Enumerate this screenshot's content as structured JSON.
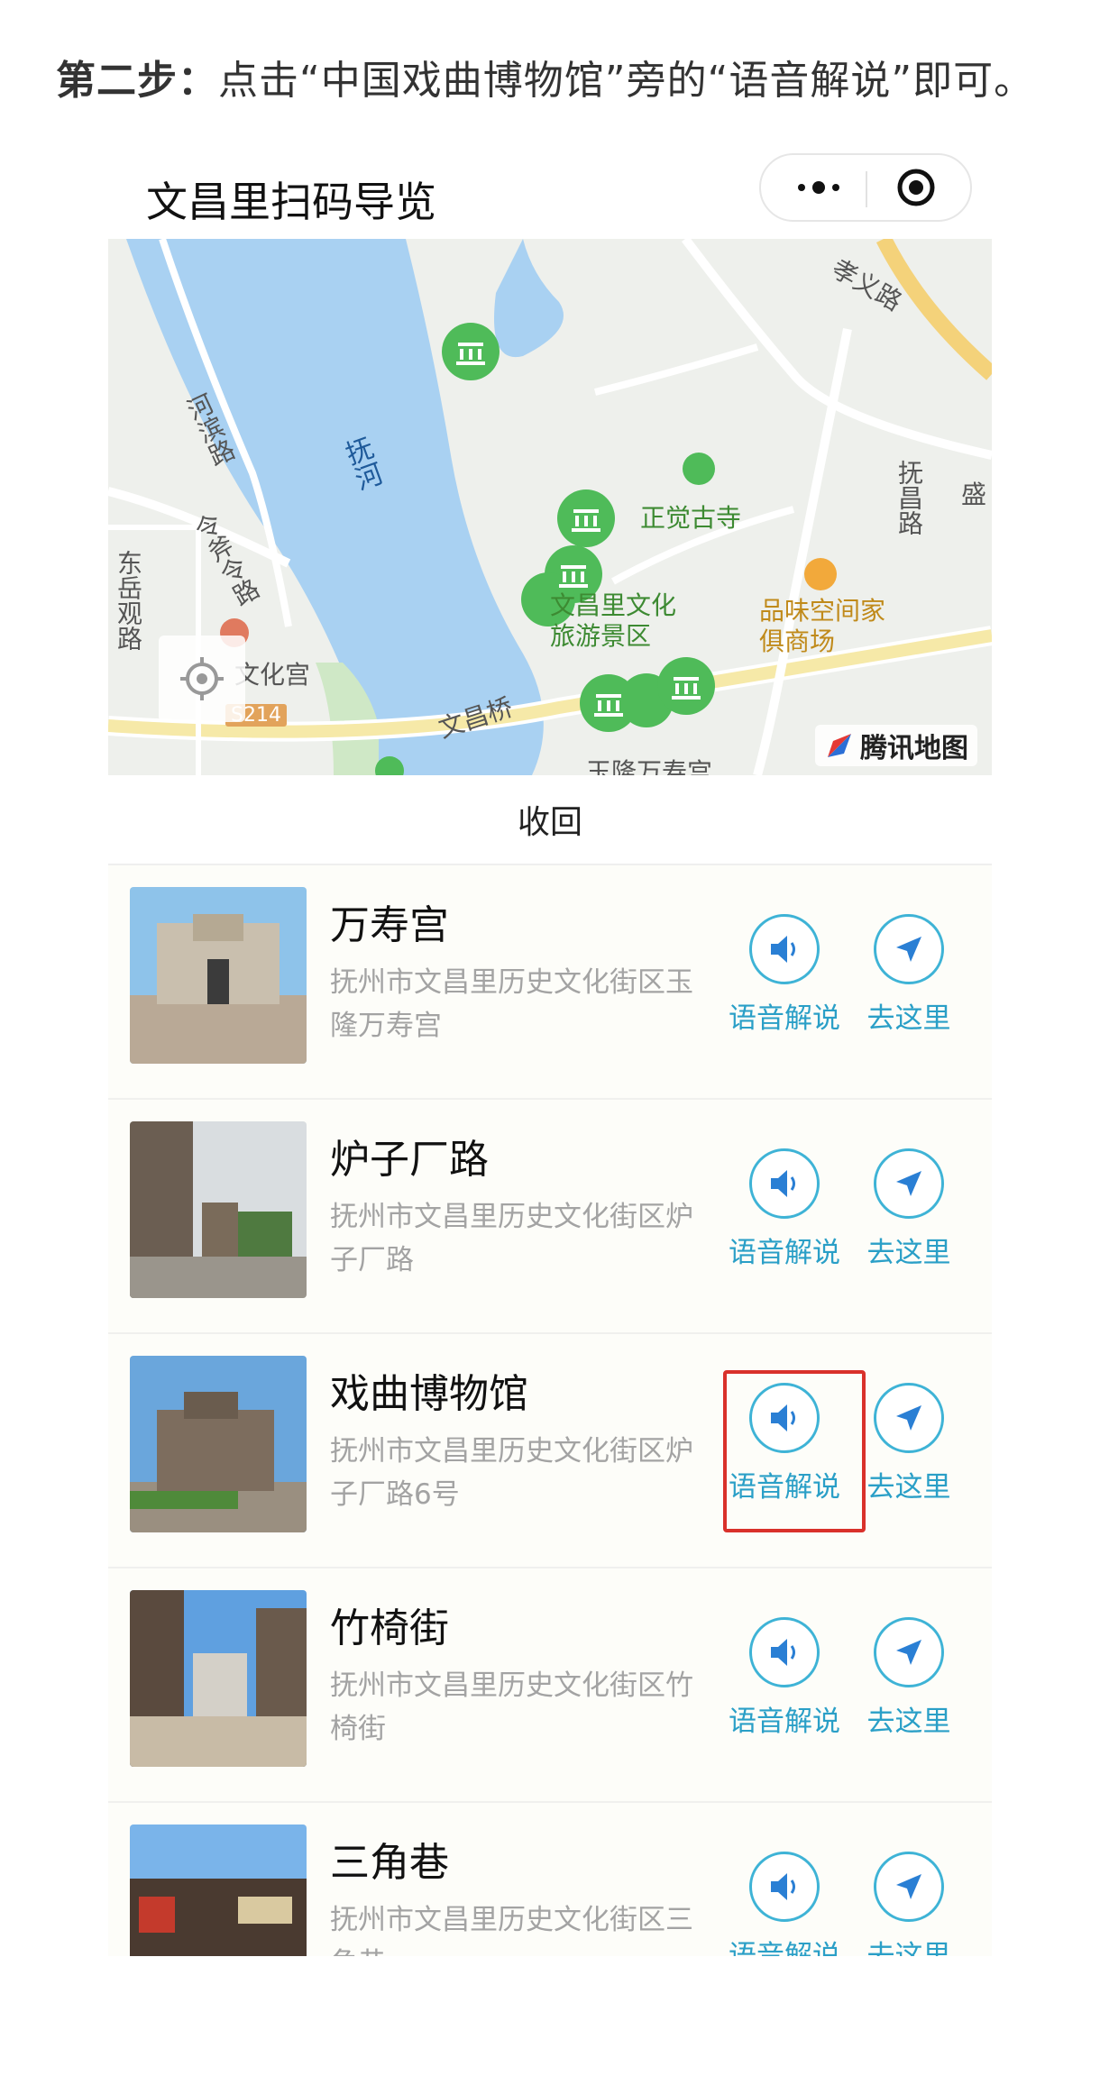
{
  "instruction": {
    "step_label": "第二步：",
    "text": "点击“中国戏曲博物馆”旁的“语音解说”即可。"
  },
  "app": {
    "title": "文昌里扫码导览",
    "more_icon": "more-dots-icon",
    "close_icon": "target-close-icon"
  },
  "map": {
    "labels": {
      "river": "抚河",
      "road_hebin": "河滨路",
      "road_dongyue": "东岳观路",
      "road_xiaoyi": "孝义路",
      "road_fuchang": "抚昌路",
      "road_lingshi": "令斧令路",
      "bridge": "文昌桥",
      "temple": "正觉古寺",
      "scenic": "文昌里文化旅游景区",
      "furniture": "品味空间家俱商场",
      "culture_palace": "文化宫",
      "wanshou": "玉隆万寿宫",
      "sheng": "盛",
      "s214": "S214"
    },
    "provider": "腾讯地图"
  },
  "collapse_label": "收回",
  "items": [
    {
      "name": "万寿宫",
      "address": "抚州市文昌里历史文化街区玉隆万寿宫",
      "audio_label": "语音解说",
      "go_label": "去这里"
    },
    {
      "name": "炉子厂路",
      "address": "抚州市文昌里历史文化街区炉子厂路",
      "audio_label": "语音解说",
      "go_label": "去这里"
    },
    {
      "name": "戏曲博物馆",
      "address": "抚州市文昌里历史文化街区炉子厂路6号",
      "audio_label": "语音解说",
      "go_label": "去这里",
      "highlighted": true
    },
    {
      "name": "竹椅街",
      "address": "抚州市文昌里历史文化街区竹椅街",
      "audio_label": "语音解说",
      "go_label": "去这里"
    },
    {
      "name": "三角巷",
      "address": "抚州市文昌里历史文化街区三角巷",
      "audio_label": "语音解说",
      "go_label": "去这里"
    }
  ],
  "colors": {
    "accent": "#2a9fc7",
    "highlight": "#d9312b",
    "map_water": "#a9d1f2",
    "map_marker": "#4fbb59"
  }
}
